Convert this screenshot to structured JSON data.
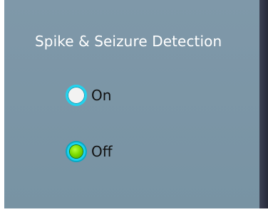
{
  "section": {
    "title": "Spike & Seizure Detection"
  },
  "options": [
    {
      "label": "On",
      "selected": false
    },
    {
      "label": "Off",
      "selected": true
    }
  ],
  "colors": {
    "panel_bg": "#7f98a9",
    "title_text": "#ffffff",
    "radio_ring": "#22d3ee",
    "radio_selected_dot": "#7fdc00",
    "label_text": "#111111"
  }
}
